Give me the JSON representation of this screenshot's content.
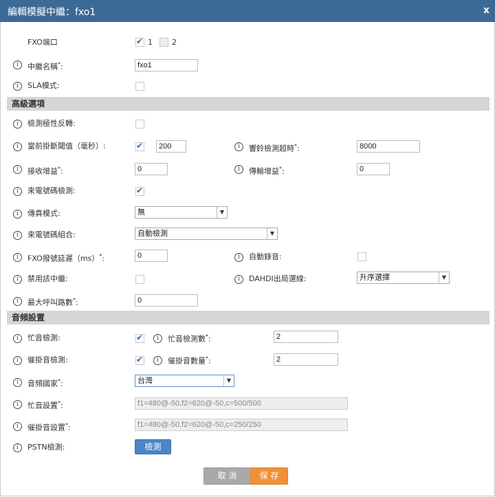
{
  "dialog": {
    "title": "編輯模擬中繼：fxo1",
    "close_label": "x"
  },
  "fxo_ports": {
    "label": "FXO端口",
    "port1": "1",
    "port2": "2"
  },
  "trunk_name": {
    "label": "中繼名稱",
    "value": "fxo1"
  },
  "sla_mode": {
    "label": "SLA模式"
  },
  "advanced": {
    "header": "高級選項",
    "polarity_reversal": "檢測極性反轉",
    "current_disconnect": {
      "label": "當前掛斷閾值（毫秒）",
      "value": "200"
    },
    "ring_timeout": {
      "label": "響鈴檢測超時",
      "value": "8000"
    },
    "rx_gain": {
      "label": "接收增益",
      "value": "0"
    },
    "tx_gain": {
      "label": "傳輸增益",
      "value": "0"
    },
    "caller_id_detect": "來電號碼檢測",
    "fax_mode": {
      "label": "傳真模式",
      "value": "無"
    },
    "caller_id_scheme": {
      "label": "來電號碼組合",
      "value": "自動檢測"
    },
    "fxo_dial_delay": {
      "label": "FXO撥號延遲（ms）",
      "value": "0"
    },
    "auto_record": "自動錄音",
    "disable_trunk": "禁用該中繼",
    "dahdi_select": {
      "label": "DAHDI出局選線",
      "value": "升序選擇"
    },
    "max_calls": {
      "label": "最大呼叫路數",
      "value": "0"
    }
  },
  "audio": {
    "header": "音頻設置",
    "busy_detect": "忙音檢測",
    "busy_count": {
      "label": "忙音檢測數",
      "value": "2"
    },
    "congestion_detect": "催掛音檢測",
    "congestion_count": {
      "label": "催掛音數量",
      "value": "2"
    },
    "tone_country": {
      "label": "音頻國家",
      "value": "台灣"
    },
    "busy_tone": {
      "label": "忙音設置",
      "value": "f1=480@-50,f2=620@-50,c=500/500"
    },
    "congestion_tone": {
      "label": "催掛音設置",
      "value": "f1=480@-50,f2=620@-50,c=250/250"
    },
    "pstn_detect": {
      "label": "PSTN檢測",
      "button": "檢測"
    }
  },
  "footer": {
    "cancel": "取 消",
    "save": "保 存"
  },
  "icons": {
    "info": "info-icon",
    "dropdown": "chevron-down-icon",
    "check": "check-icon"
  },
  "colors": {
    "titlebar": "#3c6a96",
    "primary_button": "#4a86c5",
    "save_button": "#f0913a",
    "cancel_button": "#a9a9a9",
    "checkmark": "#2d6aa5"
  }
}
